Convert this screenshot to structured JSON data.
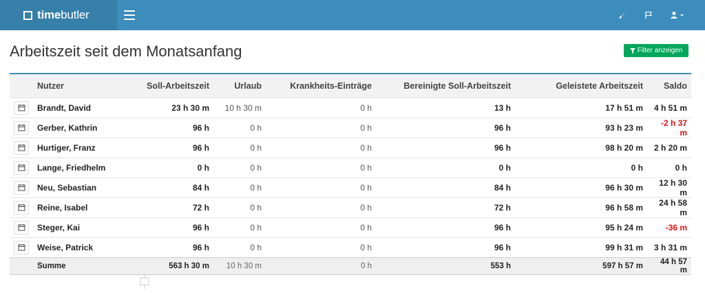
{
  "brand": {
    "name_bold": "time",
    "name_rest": "butler"
  },
  "topbar": {
    "icons": [
      "brush-icon",
      "flag-icon",
      "user-icon"
    ]
  },
  "page": {
    "title": "Arbeitszeit seit dem Monatsanfang",
    "filter_label": "Filter anzeigen"
  },
  "table": {
    "headers": {
      "user": "Nutzer",
      "target": "Soll-Arbeitszeit",
      "vacation": "Urlaub",
      "sick": "Krankheits-Einträge",
      "adjusted": "Bereinigte Soll-Arbeitszeit",
      "worked": "Geleistete Arbeitszeit",
      "balance": "Saldo"
    },
    "rows": [
      {
        "name": "Brandt, David",
        "target": "23 h 30 m",
        "vacation": "10 h 30 m",
        "sick": "0 h",
        "adjusted": "13 h",
        "worked": "17 h 51 m",
        "balance": "4 h 51 m"
      },
      {
        "name": "Gerber, Kathrin",
        "target": "96 h",
        "vacation": "0 h",
        "sick": "0 h",
        "adjusted": "96 h",
        "worked": "93 h 23 m",
        "balance": "-2 h 37 m"
      },
      {
        "name": "Hurtiger, Franz",
        "target": "96 h",
        "vacation": "0 h",
        "sick": "0 h",
        "adjusted": "96 h",
        "worked": "98 h 20 m",
        "balance": "2 h 20 m"
      },
      {
        "name": "Lange, Friedhelm",
        "target": "0 h",
        "vacation": "0 h",
        "sick": "0 h",
        "adjusted": "0 h",
        "worked": "0 h",
        "balance": "0 h"
      },
      {
        "name": "Neu, Sebastian",
        "target": "84 h",
        "vacation": "0 h",
        "sick": "0 h",
        "adjusted": "84 h",
        "worked": "96 h 30 m",
        "balance": "12 h 30 m"
      },
      {
        "name": "Reine, Isabel",
        "target": "72 h",
        "vacation": "0 h",
        "sick": "0 h",
        "adjusted": "72 h",
        "worked": "96 h 58 m",
        "balance": "24 h 58 m"
      },
      {
        "name": "Steger, Kai",
        "target": "96 h",
        "vacation": "0 h",
        "sick": "0 h",
        "adjusted": "96 h",
        "worked": "95 h 24 m",
        "balance": "-36 m"
      },
      {
        "name": "Weise, Patrick",
        "target": "96 h",
        "vacation": "0 h",
        "sick": "0 h",
        "adjusted": "96 h",
        "worked": "99 h 31 m",
        "balance": "3 h 31 m"
      }
    ],
    "footer": {
      "label": "Summe",
      "target": "563 h 30 m",
      "vacation": "10 h 30 m",
      "sick": "0 h",
      "adjusted": "553 h",
      "worked": "597 h 57 m",
      "balance": "44 h 57 m"
    }
  },
  "colors": {
    "topbar": "#3c8dbc",
    "brand_bg": "#367fa9",
    "filter_button": "#00a65a",
    "negative": "#dd1111"
  }
}
